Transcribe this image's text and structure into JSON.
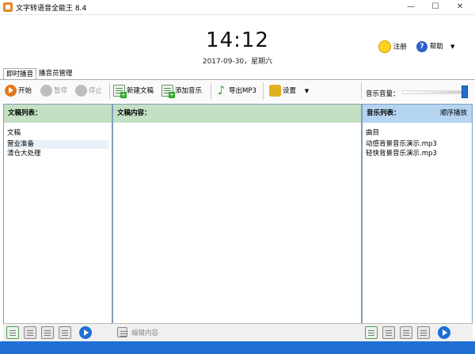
{
  "window": {
    "title": "文字转语音全能王 8.4",
    "minimize": "—",
    "maximize": "☐",
    "close": "✕"
  },
  "header": {
    "time": "14:12",
    "date": "2017-09-30，星期六",
    "register": "注册",
    "help": "帮助",
    "menu_arrow": "▼"
  },
  "tabs": [
    {
      "label": "即时播音"
    },
    {
      "label": "播音员管理"
    }
  ],
  "toolbar": {
    "start": "开始",
    "pause": "暂停",
    "stop": "停止",
    "new_doc": "新建文稿",
    "add_music": "添加音乐",
    "export_mp3": "导出MP3",
    "settings": "设置",
    "settings_arrow": "▼"
  },
  "volume": {
    "label": "音乐音量：",
    "level": 1.0
  },
  "doc_list": {
    "header": "文稿列表：",
    "items": [
      "文稿",
      "营业准备",
      "清仓大处理"
    ]
  },
  "doc_content": {
    "header": "文稿内容：",
    "edit_label": "编辑内容"
  },
  "music_list": {
    "header": "音乐列表：",
    "mode": "顺序播放",
    "items": [
      "曲目",
      "动感背景音乐演示.mp3",
      "轻快背景音乐演示.mp3"
    ]
  },
  "colors": {
    "accent": "#1f6fd4",
    "green_header": "#c3e0c3",
    "blue_header": "#b5d4f2"
  },
  "icons": {
    "app": "app-icon",
    "start": "play-icon",
    "pause": "pause-icon",
    "stop": "stop-icon",
    "new_doc": "new-doc-icon",
    "add_music": "add-music-icon",
    "export": "music-note-icon",
    "settings": "settings-icon",
    "register": "smiley-icon",
    "help": "help-icon"
  }
}
